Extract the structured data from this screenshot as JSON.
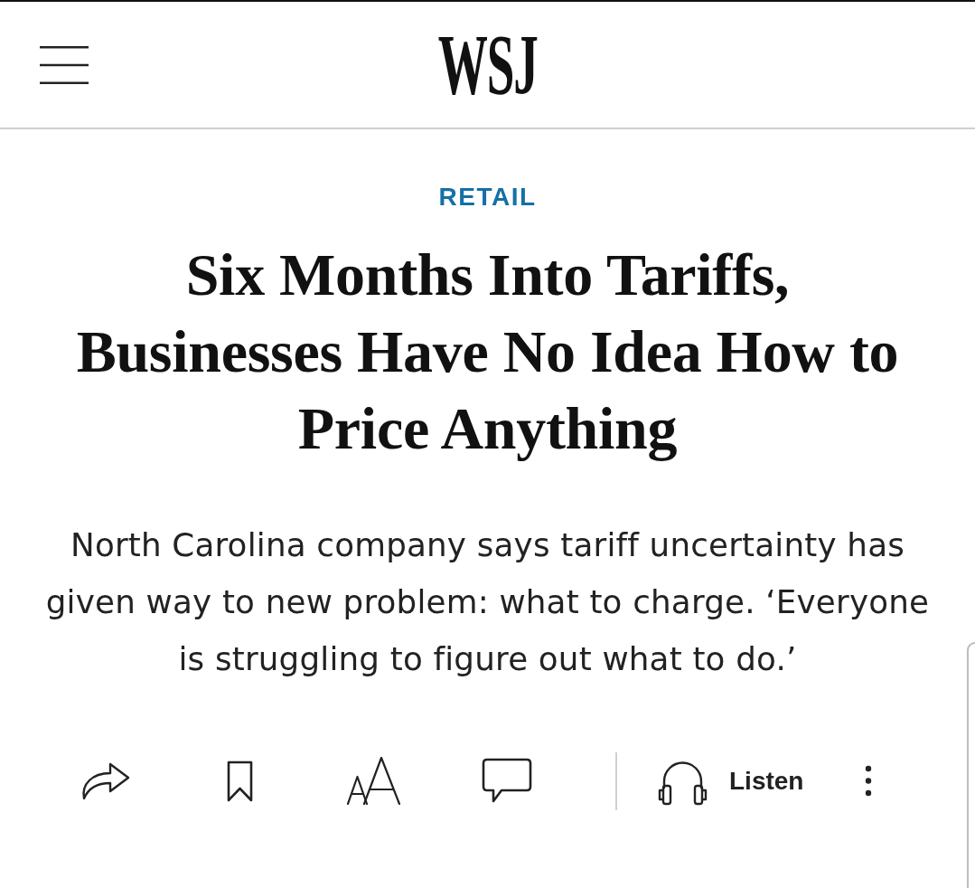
{
  "header": {
    "logo": "WSJ"
  },
  "article": {
    "section": "RETAIL",
    "headline": "Six Months Into Tariffs, Businesses Have No Idea How to Price Anything",
    "dek": "North Carolina company says tariff uncertainty has given way to new problem: what to charge. ‘Everyone is struggling to figure out what to do.’"
  },
  "toolbar": {
    "items": [
      {
        "kind": "share"
      },
      {
        "kind": "bookmark"
      },
      {
        "kind": "text-size"
      },
      {
        "kind": "comments"
      },
      {
        "kind": "divider"
      },
      {
        "kind": "listen",
        "label": "Listen"
      },
      {
        "kind": "more"
      }
    ]
  }
}
